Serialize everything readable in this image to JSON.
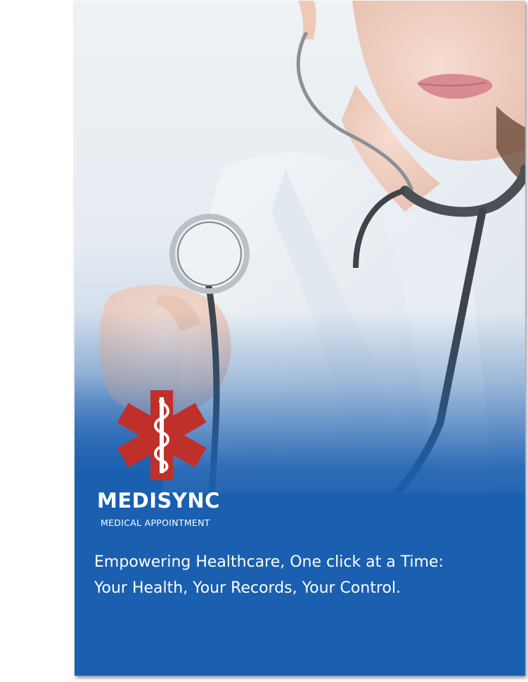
{
  "brand": {
    "name": "MEDISYNC",
    "subtitle": "MEDICAL APPOINTMENT"
  },
  "tagline": {
    "line1": "Empowering Healthcare, One click at a Time:",
    "line2": "Your Health, Your Records, Your Control."
  },
  "colors": {
    "brand_blue": "#1a5fb0",
    "logo_red": "#c0302a"
  },
  "icons": {
    "logo": "star-of-life-icon"
  }
}
